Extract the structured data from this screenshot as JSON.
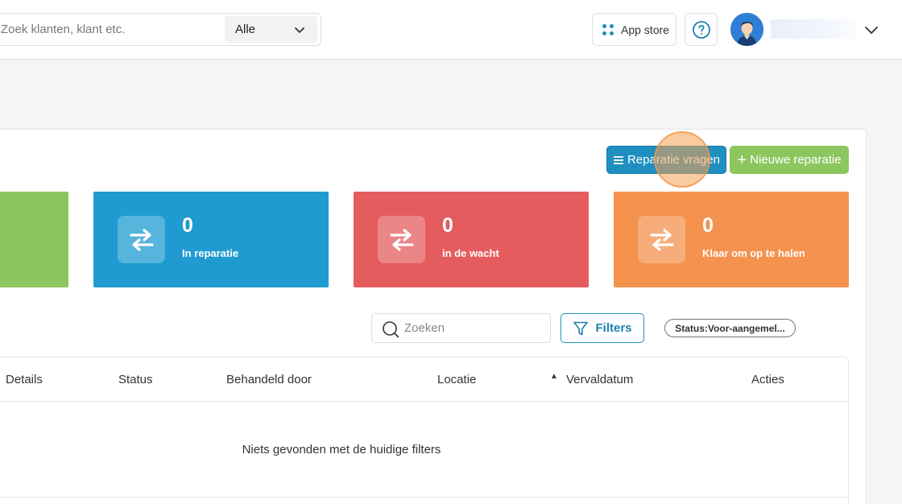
{
  "header": {
    "search_placeholder": "Zoek klanten, klant etc.",
    "scope_value": "Alle",
    "appstore_label": "App store"
  },
  "actions": {
    "ask_repair_label": "Reparatie vragen",
    "new_repair_label": "Nieuwe reparatie"
  },
  "cards": [
    {
      "count": "0",
      "label": "In reparatie",
      "color": "#1f9bd1"
    },
    {
      "count": "0",
      "label": "in de wacht",
      "color": "#e55c5e"
    },
    {
      "count": "0",
      "label": "Klaar om op te halen",
      "color": "#f4924e"
    }
  ],
  "table_toolbar": {
    "search_placeholder": "Zoeken",
    "filters_label": "Filters",
    "status_chip": "Status:Voor-aangemel..."
  },
  "table": {
    "columns": [
      "Details",
      "Status",
      "Behandeld door",
      "Locatie",
      "Vervaldatum",
      "Acties"
    ],
    "sort_indicator": "▲",
    "empty_message": "Niets gevonden met de huidige filters"
  },
  "colors": {
    "primary": "#1f8fc0",
    "success": "#8cc65f",
    "danger": "#e55c5e",
    "warning": "#f4924e"
  }
}
